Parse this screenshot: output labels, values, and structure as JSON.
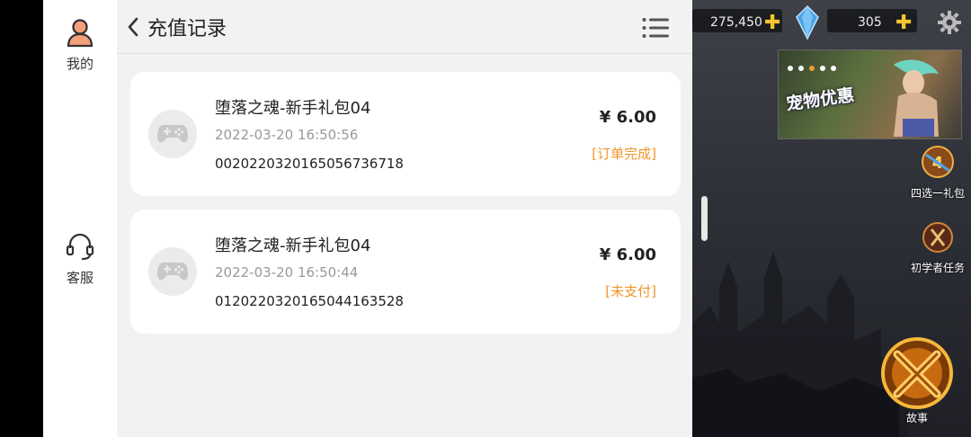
{
  "nav": {
    "me_label": "我的",
    "service_label": "客服"
  },
  "header": {
    "title": "充值记录",
    "back_icon": "chevron-left-icon",
    "menu_icon": "list-menu-icon"
  },
  "records": [
    {
      "name": "堕落之魂-新手礼包04",
      "time": "2022-03-20 16:50:56",
      "order_no": "002022032016505673671​8",
      "price": "¥ 6.00",
      "status": "[订单完成]"
    },
    {
      "name": "堕落之魂-新手礼包04",
      "time": "2022-03-20 16:50:44",
      "order_no": "012022032016504416352​8",
      "price": "¥ 6.00",
      "status": "[未支付]"
    }
  ],
  "game": {
    "resource1": "275,450",
    "resource2": "305",
    "banner_text": "宠物优惠",
    "btn_pick_pack": "四选一礼包",
    "btn_beginner_task": "初学者任务",
    "btn_story": "故事"
  },
  "colors": {
    "status_orange": "#f0962a",
    "panel_bg": "#f2f2f2",
    "gold": "#f5c531"
  }
}
